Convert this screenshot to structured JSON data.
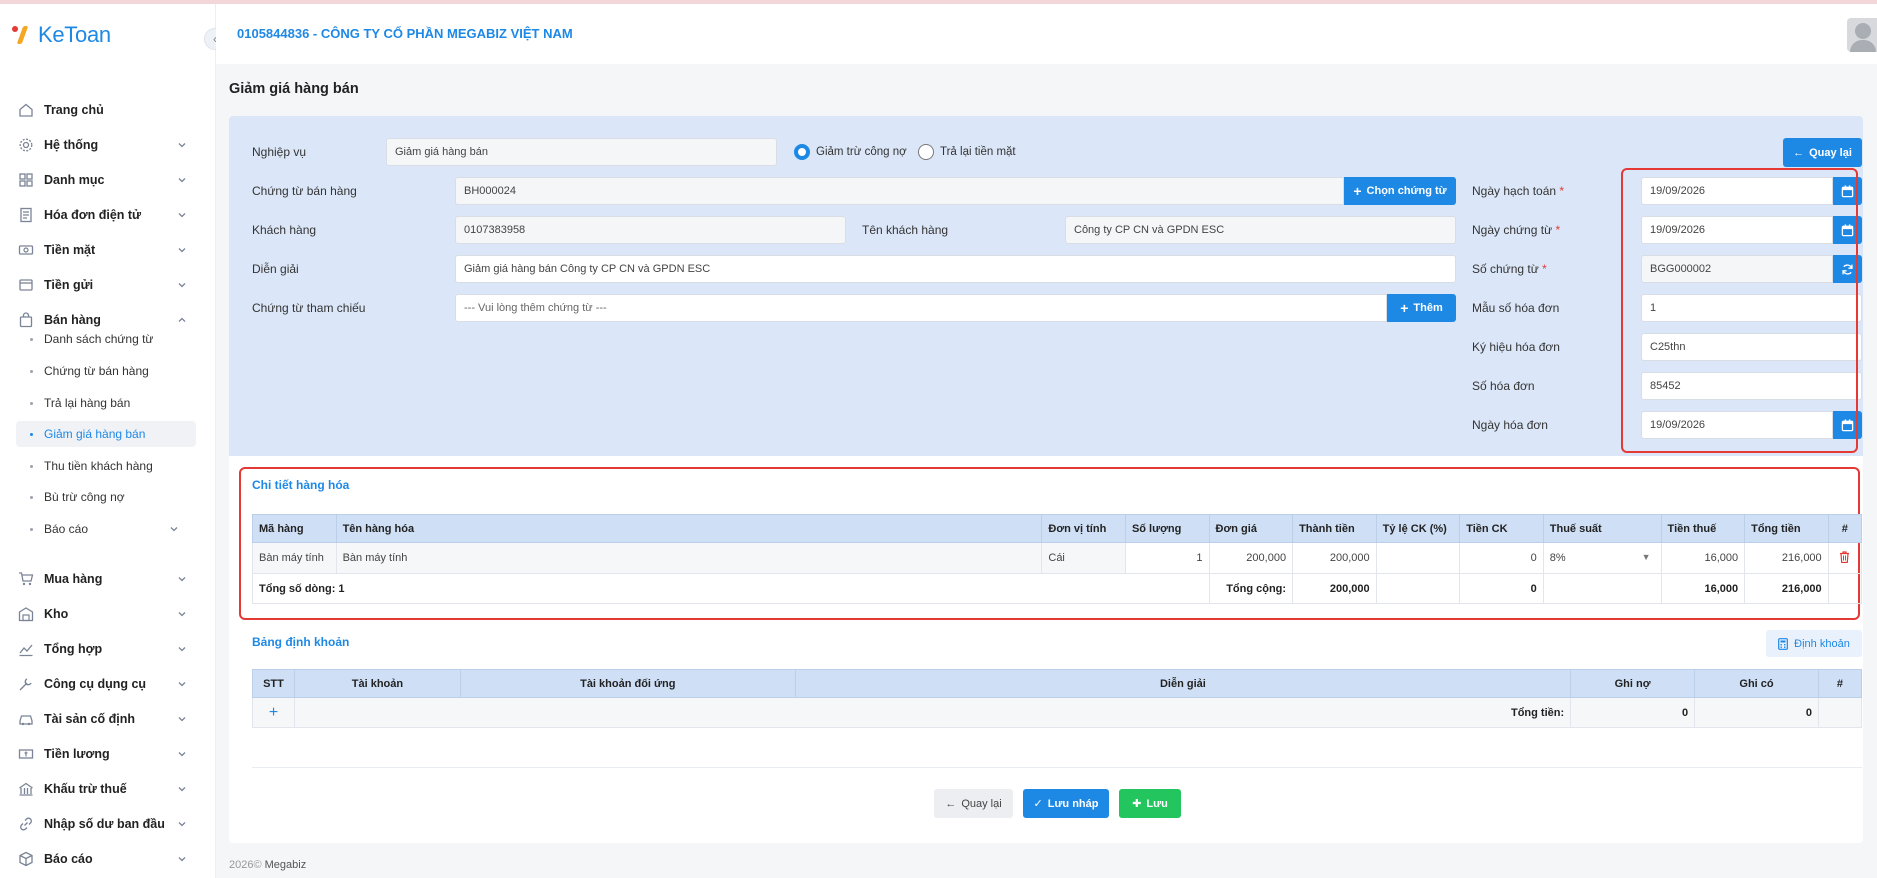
{
  "app": {
    "name": "KeToan"
  },
  "header": {
    "company": "0105844836 - CÔNG TY CỔ PHẦN MEGABIZ VIỆT NAM"
  },
  "sidebar": {
    "items": [
      {
        "label": "Trang chủ",
        "icon": "home-icon"
      },
      {
        "label": "Hệ thống",
        "icon": "gear-icon"
      },
      {
        "label": "Danh mục",
        "icon": "grid-icon"
      },
      {
        "label": "Hóa đơn điện tử",
        "icon": "invoice-icon"
      },
      {
        "label": "Tiền mặt",
        "icon": "cash-icon"
      },
      {
        "label": "Tiền gửi",
        "icon": "bank-icon"
      },
      {
        "label": "Bán hàng",
        "icon": "bag-icon"
      },
      {
        "label": "Mua hàng",
        "icon": "cart-icon"
      },
      {
        "label": "Kho",
        "icon": "warehouse-icon"
      },
      {
        "label": "Tổng hợp",
        "icon": "chart-icon"
      },
      {
        "label": "Công cụ dụng cụ",
        "icon": "tool-icon"
      },
      {
        "label": "Tài sản cố định",
        "icon": "car-icon"
      },
      {
        "label": "Tiền lương",
        "icon": "money-icon"
      },
      {
        "label": "Khấu trừ thuế",
        "icon": "tax-icon"
      },
      {
        "label": "Nhập số dư ban đầu",
        "icon": "link-icon"
      },
      {
        "label": "Báo cáo",
        "icon": "box-icon"
      }
    ],
    "sub_items": [
      {
        "label": "Danh sách chứng từ"
      },
      {
        "label": "Chứng từ bán hàng"
      },
      {
        "label": "Trả lại hàng bán"
      },
      {
        "label": "Giảm giá hàng bán"
      },
      {
        "label": "Thu tiền khách hàng"
      },
      {
        "label": "Bù trừ công nợ"
      },
      {
        "label": "Báo cáo"
      }
    ]
  },
  "page": {
    "title": "Giảm giá hàng bán"
  },
  "form": {
    "nghiep_vu_label": "Nghiệp vụ",
    "nghiep_vu_value": "Giảm giá hàng bán",
    "radio1": "Giảm trừ công nợ",
    "radio2": "Trả lại tiền mặt",
    "back_btn": "Quay lại",
    "ctbh_label": "Chứng từ bán hàng",
    "ctbh_value": "BH000024",
    "chon_ct_btn": "Chọn chứng từ",
    "kh_label": "Khách hàng",
    "kh_value": "0107383958",
    "ten_kh_label": "Tên khách hàng",
    "ten_kh_value": "Công ty CP CN và GPDN ESC",
    "dien_giai_label": "Diễn giải",
    "dien_giai_value": "Giảm giá hàng bán Công ty CP CN và GPDN ESC",
    "ct_tham_chieu_label": "Chứng từ tham chiếu",
    "ct_tham_chieu_placeholder": "--- Vui lòng thêm chứng từ ---",
    "them_btn": "Thêm",
    "ngay_hach_toan_label": "Ngày hạch toán",
    "ngay_hach_toan_value": "19/09/2026",
    "ngay_chung_tu_label": "Ngày chứng từ",
    "ngay_chung_tu_value": "19/09/2026",
    "so_chung_tu_label": "Số chứng từ",
    "so_chung_tu_value": "BGG000002",
    "mau_so_label": "Mẫu số hóa đơn",
    "mau_so_value": "1",
    "ky_hieu_label": "Ký hiệu hóa đơn",
    "ky_hieu_value": "C25thn",
    "so_hd_label": "Số hóa đơn",
    "so_hd_value": "85452",
    "ngay_hd_label": "Ngày hóa đơn",
    "ngay_hd_value": "19/09/2026",
    "required_mark": "*"
  },
  "detail": {
    "title": "Chi tiết hàng hóa",
    "headers": [
      "Mã hàng",
      "Tên hàng hóa",
      "Đơn vị tính",
      "Số lượng",
      "Đơn giá",
      "Thành tiền",
      "Tỷ lệ CK (%)",
      "Tiền CK",
      "Thuế suất",
      "Tiền thuế",
      "Tổng tiền",
      "#"
    ],
    "row": {
      "ma_hang": "Bàn máy tính",
      "ten_hang": "Bàn máy tính",
      "dvt": "Cái",
      "so_luong": "1",
      "don_gia": "200,000",
      "thanh_tien": "200,000",
      "ty_le_ck": "",
      "tien_ck": "0",
      "thue_suat": "8%",
      "tien_thue": "16,000",
      "tong_tien": "216,000"
    },
    "total": {
      "count_label": "Tổng số dòng: 1",
      "label": "Tổng cộng:",
      "thanh_tien": "200,000",
      "tien_ck": "0",
      "tien_thue": "16,000",
      "tong_tien": "216,000"
    }
  },
  "dinh_khoan": {
    "title": "Bảng định khoản",
    "btn": "Định khoản",
    "headers": [
      "STT",
      "Tài khoản",
      "Tài khoản đối ứng",
      "Diễn giải",
      "Ghi nợ",
      "Ghi có",
      "#"
    ],
    "add": "+",
    "total_label": "Tổng tiền:",
    "ghi_no": "0",
    "ghi_co": "0"
  },
  "footer_actions": {
    "back": "Quay lại",
    "draft": "Lưu nháp",
    "save": "Lưu"
  },
  "footer": {
    "year": "2026©",
    "brand": "Megabiz"
  },
  "colors": {
    "accent": "#1e88e5",
    "save": "#22c55e",
    "highlight": "#e53935"
  }
}
